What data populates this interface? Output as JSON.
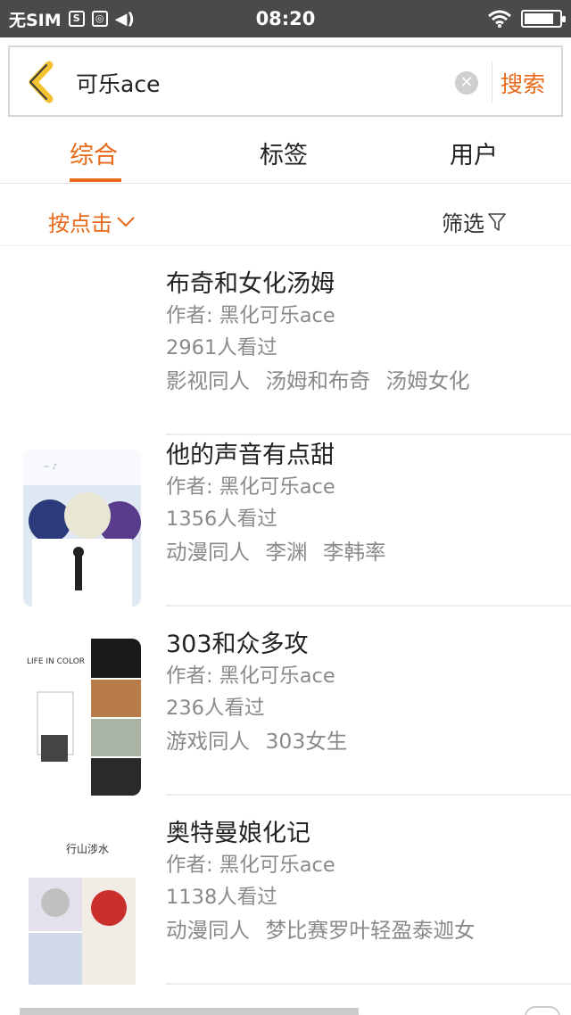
{
  "status_bar": {
    "carrier": "无SIM",
    "time": "08:20",
    "icons": [
      "sim-status-icon",
      "data-usage-icon",
      "volume-icon",
      "wifi-icon",
      "battery-icon"
    ],
    "battery_level": 0.85
  },
  "search": {
    "query": "可乐ace",
    "clear_icon": "clear-icon",
    "back_icon": "back-arrow-icon",
    "submit_label": "搜索"
  },
  "tabs": [
    {
      "label": "综合",
      "active": true
    },
    {
      "label": "标签",
      "active": false
    },
    {
      "label": "用户",
      "active": false
    }
  ],
  "filter": {
    "sort_label": "按点击",
    "filter_label": "筛选"
  },
  "results": [
    {
      "title": "布奇和女化汤姆",
      "author": "作者: 黑化可乐ace",
      "views": "2961人看过",
      "tags": [
        "影视同人",
        "汤姆和布奇",
        "汤姆女化"
      ],
      "has_cover": false
    },
    {
      "title": "他的声音有点甜",
      "author": "作者: 黑化可乐ace",
      "views": "1356人看过",
      "tags": [
        "动漫同人",
        "李渊",
        "李韩率"
      ],
      "has_cover": true
    },
    {
      "title": "303和众多攻",
      "author": "作者: 黑化可乐ace",
      "views": "236人看过",
      "tags": [
        "游戏同人",
        "303女生"
      ],
      "has_cover": true,
      "cover_text": "LIFE IN COLOR"
    },
    {
      "title": "奥特曼娘化记",
      "author": "作者: 黑化可乐ace",
      "views": "1138人看过",
      "tags": [
        "动漫同人",
        "梦比赛罗叶轻盈泰迦女"
      ],
      "has_cover": true,
      "cover_text": "行山涉水"
    }
  ],
  "colors": {
    "accent": "#e8691a",
    "status_bar": "#4a4a4a",
    "meta_text": "#8a8a8a"
  }
}
